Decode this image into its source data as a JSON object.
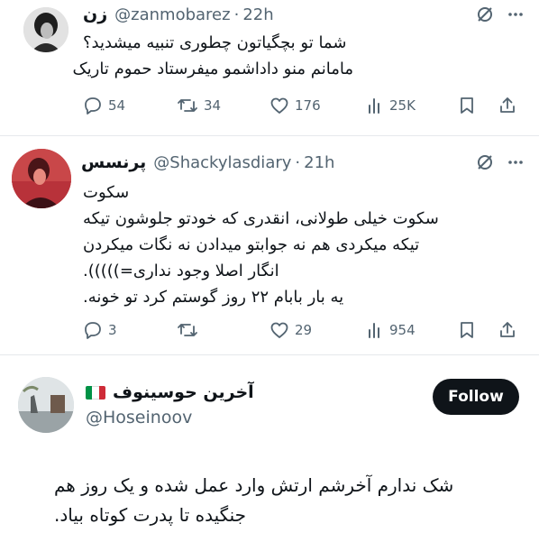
{
  "tweets": [
    {
      "display_name": "زن",
      "handle": "@zanmobarez",
      "time": "22h",
      "text": [
        "شما تو بچگیاتون چطوری تنبیه میشدید؟",
        "مامانم منو داداشمو میفرستاد حموم تاریک"
      ],
      "stats": {
        "replies": "54",
        "reposts": "34",
        "likes": "176",
        "views": "25K"
      }
    },
    {
      "display_name": "پرنسس",
      "handle": "@Shackylasdiary",
      "time": "21h",
      "text": [
        "سکوت",
        "سکوت خیلی طولانی، انقدری که خودتو جلوشون تیکه",
        "تیکه میکردی هم نه جوابتو میدادن نه نگات میکردن",
        "انگار اصلا وجود نداری=))))).",
        "یه بار بابام ۲۲ روز گوستم کرد تو خونه."
      ],
      "stats": {
        "replies": "3",
        "reposts": "",
        "likes": "29",
        "views": "954"
      }
    }
  ],
  "quote": {
    "display_name": "آخرین حوسینوف",
    "handle": "@Hoseinoov",
    "follow_label": "Follow",
    "text": [
      "شک ندارم آخرشم ارتش وارد عمل شده و یک روز هم",
      "جنگیده تا پدرت کوتاه بیاد."
    ]
  },
  "icons": {
    "top_right": [
      "grok-slash-icon",
      "more-dots-icon"
    ],
    "actions": [
      "reply-icon",
      "repost-icon",
      "like-icon",
      "views-icon",
      "bookmark-icon",
      "share-icon"
    ]
  },
  "colors": {
    "text": "#0f1419",
    "secondary": "#536471",
    "follow_bg": "#0f1419",
    "flag": [
      "#009246",
      "#ffffff",
      "#ce2b37"
    ]
  }
}
